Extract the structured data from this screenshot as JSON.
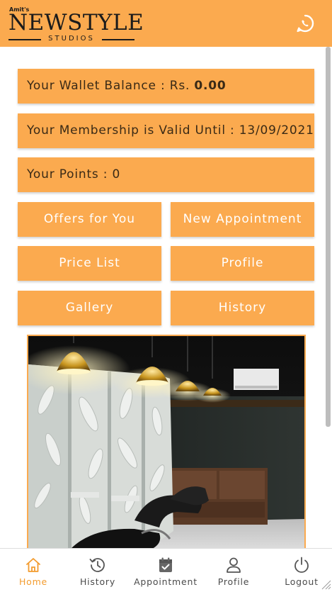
{
  "header": {
    "logo_small": "Amit's",
    "logo_big": "NEWSTYLE",
    "logo_sub": "STUDIOS",
    "whatsapp_icon": "whatsapp-icon"
  },
  "info": {
    "wallet_label": "Your Wallet Balance : Rs. ",
    "wallet_value": "0.00",
    "membership": "Your Membership is Valid Until : 13/09/2021",
    "points": "Your Points : 0"
  },
  "actions": {
    "offers": "Offers for You",
    "new_appointment": "New Appointment",
    "price_list": "Price List",
    "profile": "Profile",
    "gallery": "Gallery",
    "history": "History"
  },
  "nav": {
    "home": "Home",
    "history": "History",
    "appointment": "Appointment",
    "profile": "Profile",
    "logout": "Logout",
    "active": "home"
  },
  "colors": {
    "accent": "#fbaa4f",
    "active_nav": "#f39c2f",
    "text_dark": "#3a2a16"
  }
}
